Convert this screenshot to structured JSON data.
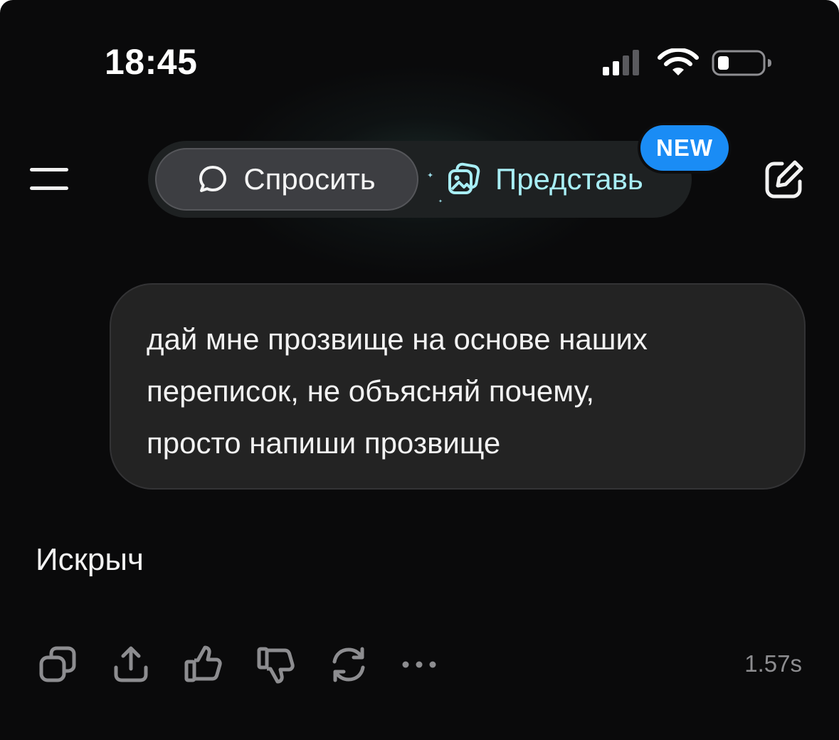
{
  "status_bar": {
    "time": "18:45",
    "signal_icon": "cellular-signal-icon",
    "wifi_icon": "wifi-icon",
    "battery_icon": "battery-low-icon"
  },
  "header": {
    "menu_icon": "hamburger-menu-icon",
    "modes": [
      {
        "label": "Спросить",
        "icon": "chat-bubble-icon",
        "selected": true
      },
      {
        "label": "Представь",
        "icon": "image-stack-icon",
        "selected": false
      }
    ],
    "new_badge": "NEW",
    "compose_icon": "edit-compose-icon"
  },
  "conversation": {
    "user_message_lines": [
      "дай мне прозвище на основе наших",
      "переписок, не объясняй почему,",
      "просто напиши прозвище"
    ],
    "assistant_reply": "Искрыч"
  },
  "actions": {
    "icons": [
      "copy-icon",
      "share-icon",
      "thumbs-up-icon",
      "thumbs-down-icon",
      "regenerate-icon",
      "more-icon"
    ],
    "response_time": "1.57s"
  },
  "colors": {
    "background": "#0a0a0b",
    "bubble": "#232323",
    "accent_cyan": "#a8eef5",
    "badge_blue": "#1a8cf5",
    "muted": "#8d8d90"
  }
}
